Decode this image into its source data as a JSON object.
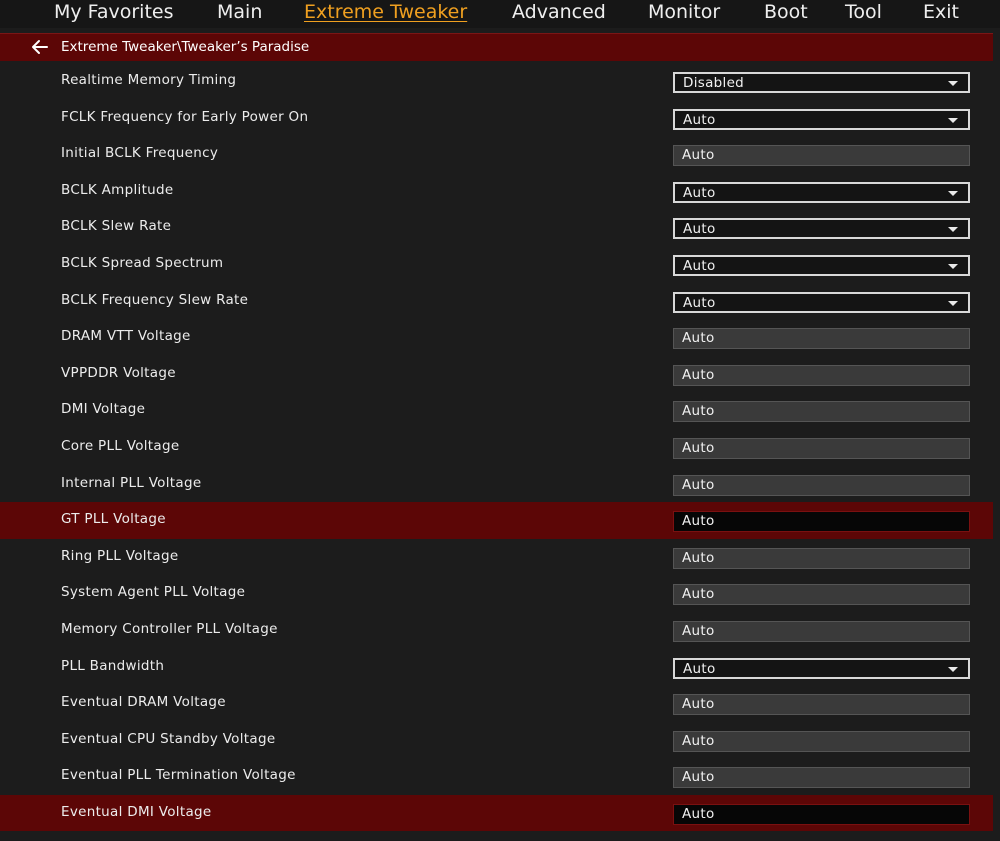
{
  "menu": {
    "tabs": [
      {
        "label": "My Favorites"
      },
      {
        "label": "Main"
      },
      {
        "label": "Extreme Tweaker"
      },
      {
        "label": "Advanced"
      },
      {
        "label": "Monitor"
      },
      {
        "label": "Boot"
      },
      {
        "label": "Tool"
      },
      {
        "label": "Exit"
      }
    ],
    "active": "Extreme Tweaker"
  },
  "breadcrumb": {
    "icon": "back-arrow-icon",
    "path": "Extreme Tweaker\\Tweaker’s Paradise"
  },
  "settings": [
    {
      "label": "Realtime Memory Timing",
      "value": "Disabled",
      "control": "dropdown"
    },
    {
      "label": "FCLK Frequency for Early Power On",
      "value": "Auto",
      "control": "dropdown"
    },
    {
      "label": "Initial BCLK Frequency",
      "value": "Auto",
      "control": "field"
    },
    {
      "label": "BCLK Amplitude",
      "value": "Auto",
      "control": "dropdown"
    },
    {
      "label": "BCLK Slew Rate",
      "value": "Auto",
      "control": "dropdown"
    },
    {
      "label": "BCLK Spread Spectrum",
      "value": "Auto",
      "control": "dropdown"
    },
    {
      "label": "BCLK Frequency Slew Rate",
      "value": "Auto",
      "control": "dropdown"
    },
    {
      "label": "DRAM VTT Voltage",
      "value": "Auto",
      "control": "field"
    },
    {
      "label": "VPPDDR Voltage",
      "value": "Auto",
      "control": "field"
    },
    {
      "label": "DMI Voltage",
      "value": "Auto",
      "control": "field"
    },
    {
      "label": "Core PLL Voltage",
      "value": "Auto",
      "control": "field"
    },
    {
      "label": "Internal PLL Voltage",
      "value": "Auto",
      "control": "field"
    },
    {
      "label": "GT PLL Voltage",
      "value": "Auto",
      "control": "field",
      "selected": true
    },
    {
      "label": "Ring PLL Voltage",
      "value": "Auto",
      "control": "field"
    },
    {
      "label": "System Agent PLL Voltage",
      "value": "Auto",
      "control": "field"
    },
    {
      "label": "Memory Controller PLL Voltage",
      "value": "Auto",
      "control": "field"
    },
    {
      "label": "PLL Bandwidth",
      "value": "Auto",
      "control": "dropdown"
    },
    {
      "label": "Eventual DRAM Voltage",
      "value": "Auto",
      "control": "field"
    },
    {
      "label": "Eventual CPU Standby Voltage",
      "value": "Auto",
      "control": "field"
    },
    {
      "label": "Eventual PLL Termination Voltage",
      "value": "Auto",
      "control": "field"
    },
    {
      "label": "Eventual DMI Voltage",
      "value": "Auto",
      "control": "field",
      "selected": true
    }
  ],
  "colors": {
    "accent": "#f0a020",
    "selected_row": "#5c0606",
    "background": "#1c1c1c"
  }
}
